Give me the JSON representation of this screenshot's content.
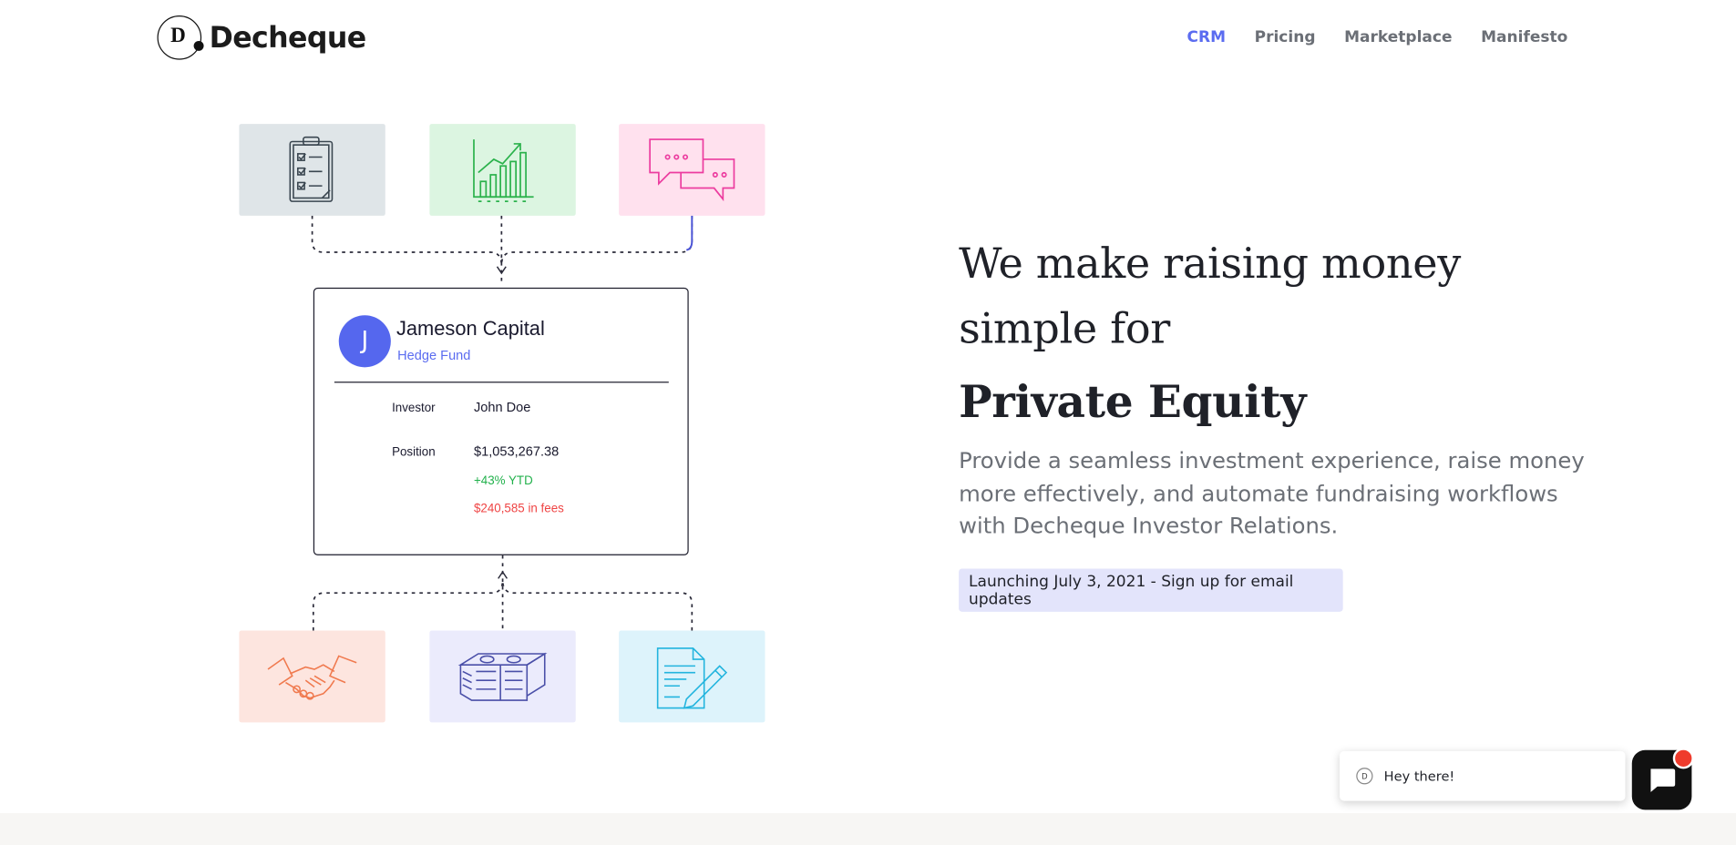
{
  "brand": {
    "letter": "D",
    "name": "Decheque"
  },
  "nav": [
    {
      "label": "CRM",
      "active": true
    },
    {
      "label": "Pricing",
      "active": false
    },
    {
      "label": "Marketplace",
      "active": false
    },
    {
      "label": "Manifesto",
      "active": false
    }
  ],
  "tiles_top": [
    {
      "icon": "clipboard-checklist-icon",
      "color": "#dfe5e8"
    },
    {
      "icon": "growth-bar-chart-icon",
      "color": "#dcf5e1"
    },
    {
      "icon": "chat-bubbles-icon",
      "color": "#ffe1ee"
    }
  ],
  "tiles_bottom": [
    {
      "icon": "handshake-icon",
      "color": "#fde5df"
    },
    {
      "icon": "money-stack-icon",
      "color": "#ebebfc"
    },
    {
      "icon": "signed-document-icon",
      "color": "#ddf3fb"
    }
  ],
  "card": {
    "avatar_letter": "J",
    "name": "Jameson Capital",
    "type": "Hedge Fund",
    "investor_label": "Investor",
    "investor_value": "John Doe",
    "position_label": "Position",
    "position_value": "$1,053,267.38",
    "ytd": "+43% YTD",
    "fees": "$240,585 in fees"
  },
  "hero": {
    "line1": "We make raising money",
    "line2": "simple for",
    "line3": "Private Equity",
    "lead": "Provide a seamless investment experience, raise money more effectively, and automate fundraising workflows with Decheque Investor Relations.",
    "cta": "Launching July 3, 2021 - Sign up for email updates"
  },
  "chat": {
    "avatar_letter": "D",
    "message": "Hey there!"
  },
  "colors": {
    "accent": "#5b6cf0",
    "positive": "#22b14c",
    "negative": "#ef4444",
    "notification": "#ef3b2c"
  }
}
